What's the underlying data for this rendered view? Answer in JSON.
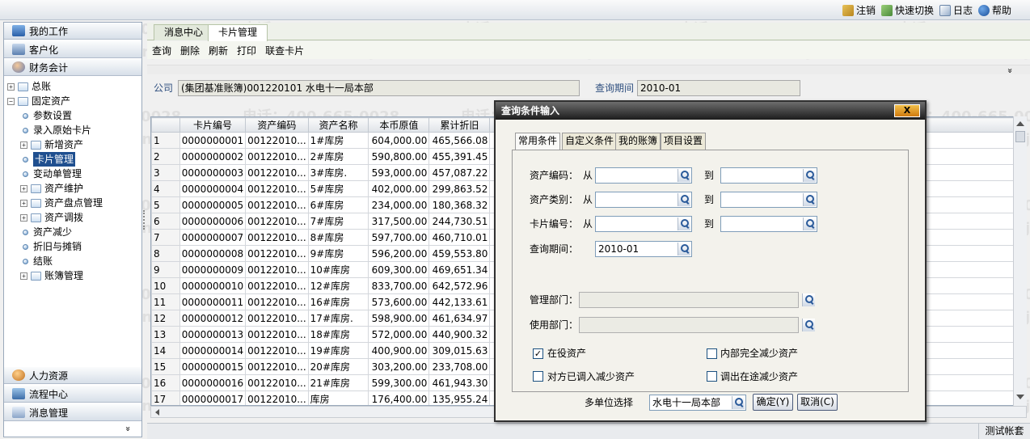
{
  "topbar": {
    "logout": "注销",
    "quick_switch": "快速切换",
    "log": "日志",
    "help": "帮助"
  },
  "nav": {
    "my_work": "我的工作",
    "personalize": "客户化",
    "finance": "财务会计",
    "hr": "人力资源",
    "workflow": "流程中心",
    "messages": "消息管理",
    "collapse_arrow": "»"
  },
  "tree": [
    {
      "label": "总账",
      "toggle": "+",
      "kind": "folder",
      "level": 0
    },
    {
      "label": "固定资产",
      "toggle": "−",
      "kind": "folder",
      "level": 0
    },
    {
      "label": "参数设置",
      "kind": "leaf",
      "level": 1
    },
    {
      "label": "录入原始卡片",
      "kind": "leaf",
      "level": 1
    },
    {
      "label": "新增资产",
      "toggle": "+",
      "kind": "folder",
      "level": 1
    },
    {
      "label": "卡片管理",
      "kind": "leaf",
      "level": 1,
      "selected": true
    },
    {
      "label": "变动单管理",
      "kind": "leaf",
      "level": 1
    },
    {
      "label": "资产维护",
      "toggle": "+",
      "kind": "folder",
      "level": 1
    },
    {
      "label": "资产盘点管理",
      "toggle": "+",
      "kind": "folder",
      "level": 1
    },
    {
      "label": "资产调拨",
      "toggle": "+",
      "kind": "folder",
      "level": 1
    },
    {
      "label": "资产减少",
      "kind": "leaf",
      "level": 1
    },
    {
      "label": "折旧与摊销",
      "kind": "leaf",
      "level": 1
    },
    {
      "label": "结账",
      "kind": "leaf",
      "level": 1
    },
    {
      "label": "账簿管理",
      "toggle": "+",
      "kind": "folder",
      "level": 1
    }
  ],
  "tabs": [
    "消息中心",
    "卡片管理"
  ],
  "toolbar": [
    "查询",
    "删除",
    "刷新",
    "打印",
    "联查卡片"
  ],
  "filter": {
    "company_label": "公司",
    "company_value": "(集团基准账簿)001220101 水电十一局本部",
    "period_label": "查询期间",
    "period_value": "2010-01",
    "collapse_icon": "»"
  },
  "grid": {
    "columns": [
      "卡片编号",
      "资产编码",
      "资产名称",
      "本币原值",
      "累计折旧"
    ],
    "rows": [
      [
        "1",
        "0000000001",
        "00122010...",
        "1#库房",
        "604,000.00",
        "465,566.08"
      ],
      [
        "2",
        "0000000002",
        "00122010...",
        "2#库房",
        "590,800.00",
        "455,391.45"
      ],
      [
        "3",
        "0000000003",
        "00122010...",
        "3#库房.",
        "593,000.00",
        "457,087.22"
      ],
      [
        "4",
        "0000000004",
        "00122010...",
        "5#库房",
        "402,000.00",
        "299,863.52"
      ],
      [
        "5",
        "0000000005",
        "00122010...",
        "6#库房",
        "234,000.00",
        "180,368.32"
      ],
      [
        "6",
        "0000000006",
        "00122010...",
        "7#库房",
        "317,500.00",
        "244,730.51"
      ],
      [
        "7",
        "0000000007",
        "00122010...",
        "8#库房",
        "597,700.00",
        "460,710.01"
      ],
      [
        "8",
        "0000000008",
        "00122010...",
        "9#库房",
        "596,200.00",
        "459,553.80"
      ],
      [
        "9",
        "0000000009",
        "00122010...",
        "10#库房",
        "609,300.00",
        "469,651.34"
      ],
      [
        "10",
        "0000000010",
        "00122010...",
        "12#库房",
        "833,700.00",
        "642,572.96"
      ],
      [
        "11",
        "0000000011",
        "00122010...",
        "16#库房",
        "573,600.00",
        "442,133.61"
      ],
      [
        "12",
        "0000000012",
        "00122010...",
        "17#库房.",
        "598,900.00",
        "461,634.97"
      ],
      [
        "13",
        "0000000013",
        "00122010...",
        "18#库房",
        "572,000.00",
        "440,900.32"
      ],
      [
        "14",
        "0000000014",
        "00122010...",
        "19#库房",
        "400,900.00",
        "309,015.63"
      ],
      [
        "15",
        "0000000015",
        "00122010...",
        "20#库房",
        "303,200.00",
        "233,708.00"
      ],
      [
        "16",
        "0000000016",
        "00122010...",
        "21#库房",
        "599,300.00",
        "461,943.30"
      ],
      [
        "17",
        "0000000017",
        "00122010...",
        "库房",
        "176,400.00",
        "135,955.24"
      ]
    ]
  },
  "status": {
    "account": "测试帐套"
  },
  "dialog": {
    "title": "查询条件输入",
    "close": "X",
    "tabs": [
      "常用条件",
      "自定义条件",
      "我的账簿",
      "项目设置"
    ],
    "asset_code": "资产编码：",
    "asset_type": "资产类别：",
    "card_no": "卡片编号：",
    "from": "从",
    "to": "到",
    "period": "查询期间：",
    "period_value": "2010-01",
    "mgmt_dept": "管理部门：",
    "use_dept": "使用部门：",
    "in_service": "在役资产",
    "internal_reduced": "内部完全减少资产",
    "counterpart_reduced": "对方已调入减少资产",
    "in_transit": "调出在途减少资产",
    "multi_unit": "多单位选择",
    "multi_unit_value": "水电十一局本部",
    "ok": "确定(Y)",
    "cancel": "取消(C)",
    "check_mark": "✓"
  },
  "watermark": {
    "phone": "电话：400-665-0028",
    "site": "网址：www.chanjet.net"
  }
}
